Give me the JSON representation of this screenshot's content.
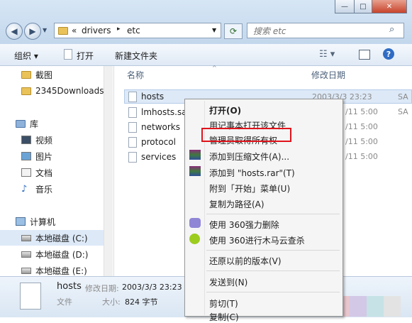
{
  "address": {
    "prefix": "«",
    "parts": [
      "drivers",
      "etc"
    ],
    "separator": "▸"
  },
  "search": {
    "placeholder": "搜索 etc"
  },
  "toolbar": {
    "organize": "组织",
    "open": "打开",
    "new_folder": "新建文件夹"
  },
  "nav": {
    "items": [
      {
        "label": "截图",
        "icon": "folder-icon"
      },
      {
        "label": "2345Downloads",
        "icon": "folder-icon"
      },
      {
        "label": "库",
        "icon": "library-icon"
      },
      {
        "label": "视频",
        "icon": "video-icon"
      },
      {
        "label": "图片",
        "icon": "picture-icon"
      },
      {
        "label": "文档",
        "icon": "document-icon"
      },
      {
        "label": "音乐",
        "icon": "music-icon"
      },
      {
        "label": "计算机",
        "icon": "computer-icon"
      },
      {
        "label": "本地磁盘 (C:)",
        "icon": "drive-icon"
      },
      {
        "label": "本地磁盘 (D:)",
        "icon": "drive-icon"
      },
      {
        "label": "本地磁盘 (E:)",
        "icon": "drive-icon"
      }
    ]
  },
  "columns": {
    "name": "名称",
    "modified": "修改日期"
  },
  "files": [
    {
      "name": "hosts",
      "date": "2003/3/3 23:23",
      "type": "SA"
    },
    {
      "name": "lmhosts.sa",
      "date": "/11 5:00",
      "type": "SA"
    },
    {
      "name": "networks",
      "date": "/11 5:00",
      "type": ""
    },
    {
      "name": "protocol",
      "date": "/11 5:00",
      "type": ""
    },
    {
      "name": "services",
      "date": "/11 5:00",
      "type": ""
    }
  ],
  "menu": {
    "open": "打开(O)",
    "open_notepad": "用记事本打开该文件",
    "take_ownership": "管理员取得所有权",
    "add_archive": "添加到压缩文件(A)...",
    "add_hosts_rar": "添加到 \"hosts.rar\"(T)",
    "pin_start": "附到「开始」菜单(U)",
    "copy_path": "复制为路径(A)",
    "force_delete": "使用 360强力删除",
    "trojan_scan": "使用 360进行木马云查杀",
    "restore": "还原以前的版本(V)",
    "send_to": "发送到(N)",
    "cut": "剪切(T)",
    "copy": "复制(C)"
  },
  "status": {
    "name": "hosts",
    "modified_label": "修改日期:",
    "modified_value": "2003/3/3 23:23",
    "type": "文件",
    "size_label": "大小:",
    "size_value": "824 字节"
  },
  "colors": {
    "highlight_box": "#e0141c",
    "selected_row": "#dde9f7"
  }
}
